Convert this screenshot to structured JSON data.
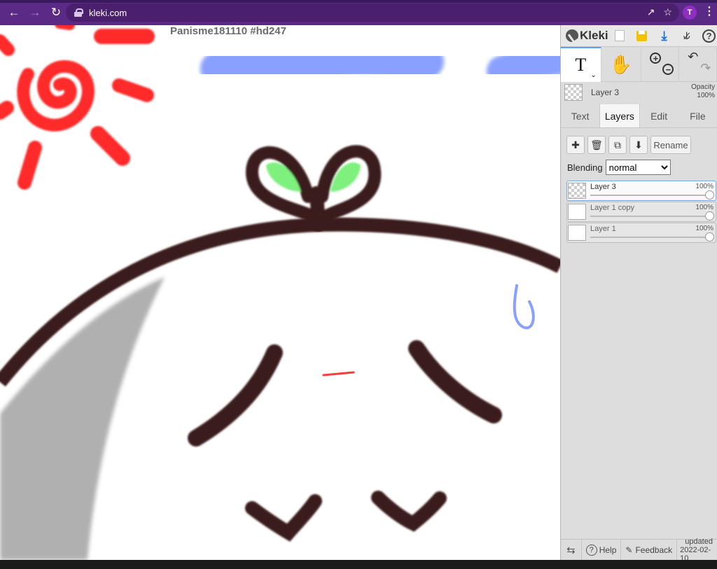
{
  "browser": {
    "url": "kleki.com",
    "profile_initial": "T"
  },
  "canvas": {
    "title": "Panisme181110 #hd247"
  },
  "panel": {
    "brand": "Kleki",
    "current_layer": "Layer 3",
    "opacity_label": "Opacity",
    "opacity_value": "100%",
    "tabs": [
      "Text",
      "Layers",
      "Edit",
      "File"
    ],
    "active_tab": "Layers",
    "rename_label": "Rename",
    "blending_label": "Blending",
    "blending_value": "normal",
    "layers": [
      {
        "name": "Layer 3",
        "opacity": "100%",
        "selected": true
      },
      {
        "name": "Layer 1 copy",
        "opacity": "100%",
        "selected": false
      },
      {
        "name": "Layer 1",
        "opacity": "100%",
        "selected": false
      }
    ],
    "bottom": {
      "help": "Help",
      "feedback": "Feedback",
      "updated_label": "updated",
      "updated_date": "2022-02-10"
    }
  },
  "colors": {
    "chrome": "#5b2a86",
    "panel": "#dddddd",
    "brown": "#3b1c1c",
    "sun": "#ff2a2a",
    "cloud": "#8aa0ff",
    "leaf": "#7ef07e"
  }
}
